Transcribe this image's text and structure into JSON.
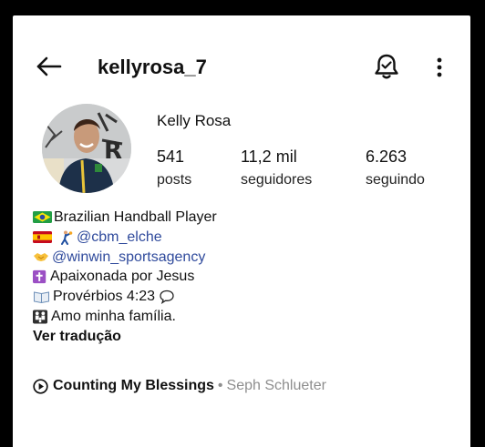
{
  "header": {
    "username": "kellyrosa_7",
    "icons": [
      "back-arrow-icon",
      "notification-bell-icon",
      "more-options-icon"
    ]
  },
  "profile": {
    "full_name": "Kelly Rosa",
    "stats": [
      {
        "value": "541",
        "label": "posts"
      },
      {
        "value": "11,2 mil",
        "label": "seguidores"
      },
      {
        "value": "6.263",
        "label": "seguindo"
      }
    ]
  },
  "bio": {
    "line1": "Brazilian Handball Player",
    "line2_link": "@cbm_elche",
    "line3_link": "@winwin_sportsagency",
    "line4": "Apaixonada por Jesus",
    "line5": "Provérbios 4:23",
    "line6": "Amo minha família.",
    "translate": "Ver tradução"
  },
  "music": {
    "song": "Counting My Blessings",
    "separator": "•",
    "artist": "Seph Schlueter"
  },
  "colors": {
    "link": "#2f4a9c",
    "secondary_text": "#8e8e8e",
    "frame": "#000000"
  }
}
